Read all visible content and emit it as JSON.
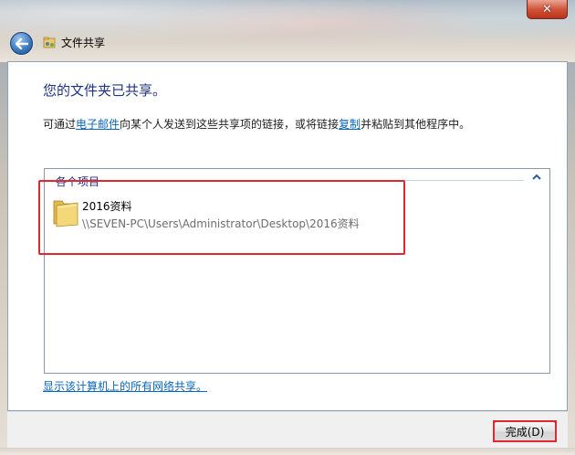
{
  "window": {
    "title": "文件共享",
    "close_glyph": "✕"
  },
  "main": {
    "heading": "您的文件夹已共享。",
    "desc_before": "可通过",
    "desc_link_email": "电子邮件",
    "desc_middle": "向某个人发送到这些共享项的链接，或将链接",
    "desc_link_copy": "复制",
    "desc_after": "并粘贴到其他程序中。",
    "group_header": "各个项目",
    "items": [
      {
        "name": "2016资料",
        "path": "\\\\SEVEN-PC\\Users\\Administrator\\Desktop\\2016资料",
        "icon": "folder-icon"
      }
    ],
    "show_all_link": "显示该计算机上的所有网络共享。"
  },
  "footer": {
    "finish_label": "完成(D)"
  },
  "colors": {
    "heading": "#1e3287",
    "link": "#0a66b8",
    "annotation": "#e0282e"
  }
}
